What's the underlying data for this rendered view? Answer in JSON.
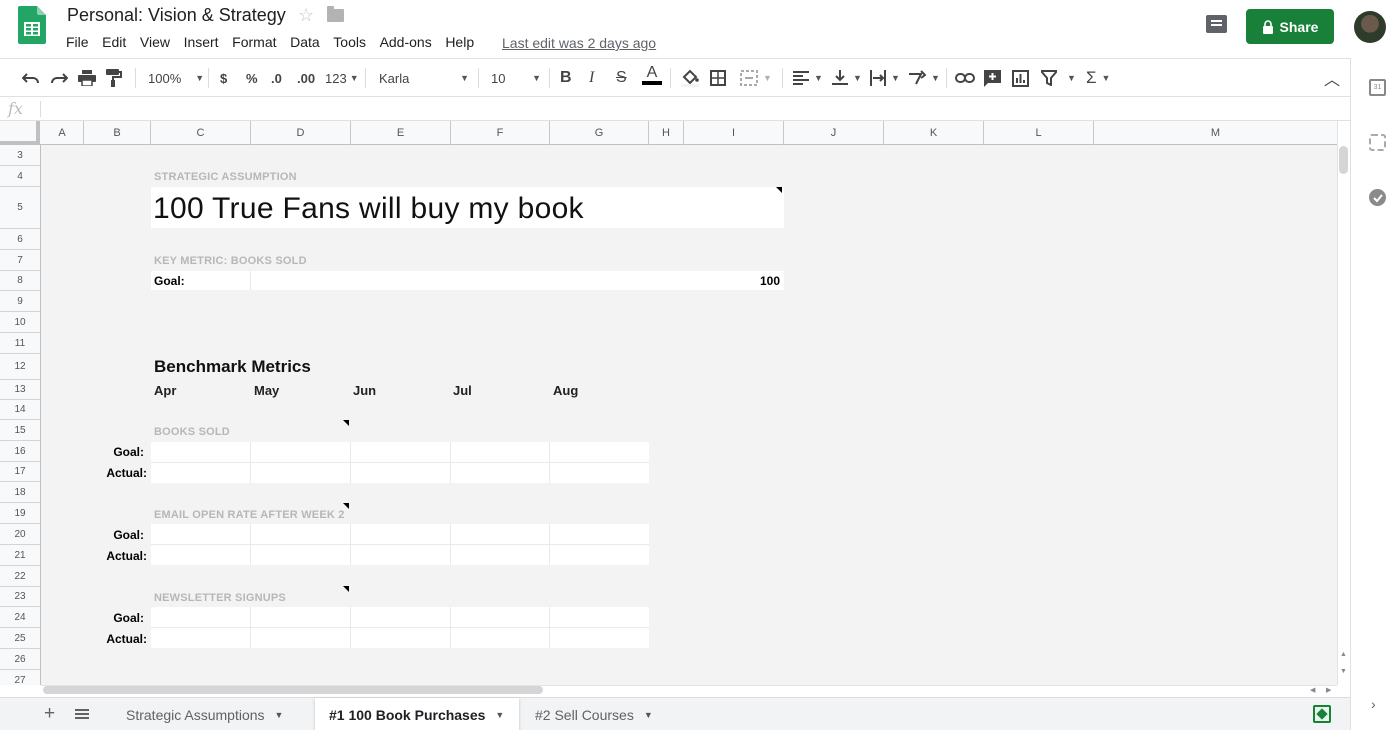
{
  "app": {
    "doc_title": "Personal: Vision & Strategy",
    "menu": [
      "File",
      "Edit",
      "View",
      "Insert",
      "Format",
      "Data",
      "Tools",
      "Add-ons",
      "Help"
    ],
    "last_edit": "Last edit was 2 days ago",
    "share_label": "Share",
    "accent_color": "#188038"
  },
  "toolbar": {
    "zoom": "100%",
    "currency": "$",
    "percent": "%",
    "dec_decrease": ".0",
    "dec_increase": ".00",
    "more_formats": "123",
    "font": "Karla",
    "font_size": "10",
    "bold": "B",
    "italic": "I",
    "strike": "S",
    "text_color": "A",
    "text_color_value": "#000000",
    "function": "Σ"
  },
  "formula_bar": {
    "fx": "fx",
    "value": ""
  },
  "columns": [
    "A",
    "B",
    "C",
    "D",
    "E",
    "F",
    "G",
    "H",
    "I",
    "J",
    "K",
    "L",
    "M"
  ],
  "rows": [
    "3",
    "4",
    "5",
    "6",
    "7",
    "8",
    "9",
    "10",
    "11",
    "12",
    "13",
    "14",
    "15",
    "16",
    "17",
    "18",
    "19",
    "20",
    "21",
    "22",
    "23",
    "24",
    "25",
    "26",
    "27"
  ],
  "sheet": {
    "strategic_label": "STRATEGIC ASSUMPTION",
    "assumption": "100 True Fans will buy my book",
    "key_metric_label": "KEY METRIC: BOOKS SOLD",
    "goal_label": "Goal:",
    "goal_value": "100",
    "benchmark_title": "Benchmark Metrics",
    "months": [
      "Apr",
      "May",
      "Jun",
      "Jul",
      "Aug"
    ],
    "metrics": [
      {
        "label": "BOOKS SOLD",
        "goal": "Goal:",
        "actual": "Actual:"
      },
      {
        "label": "EMAIL OPEN RATE AFTER WEEK 2",
        "goal": "Goal:",
        "actual": "Actual:"
      },
      {
        "label": "NEWSLETTER SIGNUPS",
        "goal": "Goal:",
        "actual": "Actual:"
      }
    ]
  },
  "tabs": [
    {
      "label": "Strategic Assumptions"
    },
    {
      "label": "#1 100 Book Purchases",
      "active": true
    },
    {
      "label": "#2 Sell Courses"
    }
  ]
}
